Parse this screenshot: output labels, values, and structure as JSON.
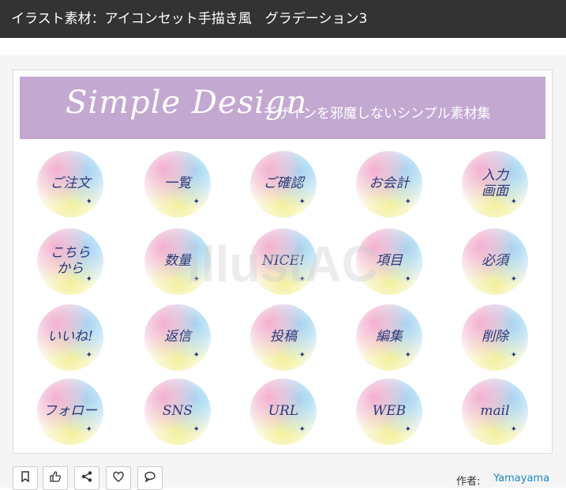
{
  "page": {
    "title": "イラスト素材：アイコンセット手描き風　グラデーション3"
  },
  "illustration": {
    "banner_script": "Simple Design",
    "banner_subtitle": "デザインを邪魔しないシンプル素材集",
    "watermark": "illustAC",
    "badges": [
      "ご注文",
      "一覧",
      "ご確認",
      "お会計",
      "入力\n画面",
      "こちら\nから",
      "数量",
      "NICE!",
      "項目",
      "必須",
      "いいね!",
      "返信",
      "投稿",
      "編集",
      "削除",
      "フォロー",
      "SNS",
      "URL",
      "WEB",
      "mail"
    ]
  },
  "actions": {
    "icons": [
      "bookmark-icon",
      "thumbs-up-icon",
      "share-icon",
      "heart-icon",
      "comment-icon"
    ]
  },
  "author": {
    "label": "作者:",
    "name": "Yamayama"
  }
}
